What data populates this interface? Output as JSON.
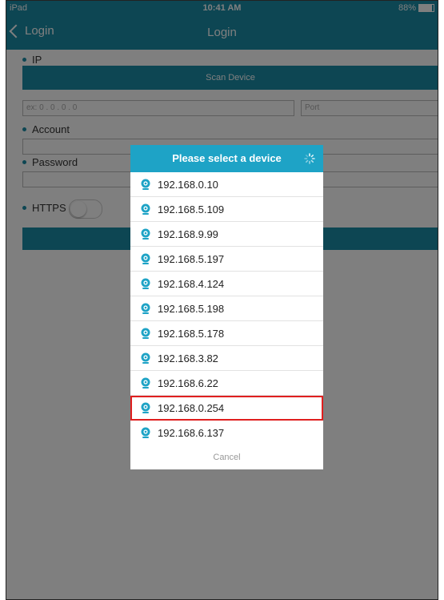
{
  "statusbar": {
    "device": "iPad",
    "time": "10:41 AM",
    "battery": "88%"
  },
  "navbar": {
    "back_label": "Login",
    "title": "Login"
  },
  "form": {
    "ip_label": "IP",
    "scan_button": "Scan Device",
    "ip_placeholder": "ex: 0 . 0 . 0 . 0",
    "port_placeholder": "Port",
    "account_label": "Account",
    "password_label": "Password",
    "https_label": "HTTPS"
  },
  "dialog": {
    "title": "Please select a device",
    "devices": [
      "192.168.0.10",
      "192.168.5.109",
      "192.168.9.99",
      "192.168.5.197",
      "192.168.4.124",
      "192.168.5.198",
      "192.168.5.178",
      "192.168.3.82",
      "192.168.6.22",
      "192.168.0.254",
      "192.168.6.137"
    ],
    "selected_device": "192.168.0.254",
    "cancel_label": "Cancel"
  },
  "colors": {
    "accent": "#1b8ca6",
    "dialog_header": "#1ea3c6",
    "highlight": "#e01f1f"
  },
  "icons": {
    "device_icon": "webcam-icon",
    "back_icon": "chevron-left-icon",
    "spinner_icon": "loading-spinner-icon"
  }
}
